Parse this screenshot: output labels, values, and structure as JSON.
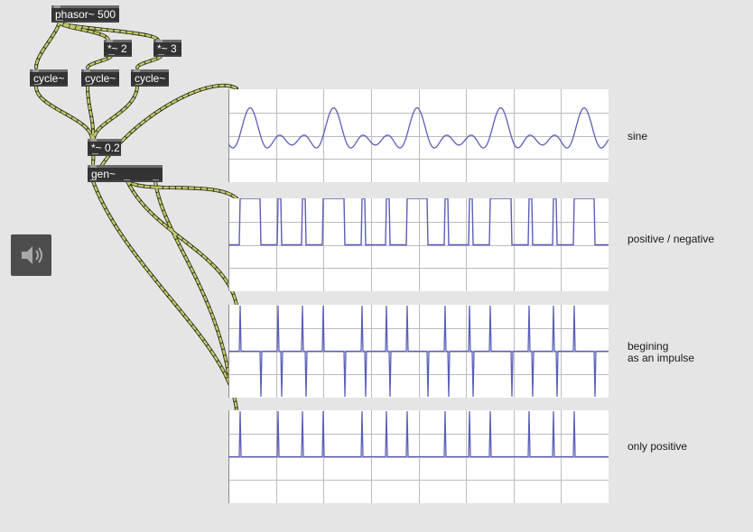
{
  "objects": {
    "phasor": "phasor~ 500",
    "mul2": "*~ 2",
    "mul3": "*~ 3",
    "cycle1": "cycle~",
    "cycle2": "cycle~",
    "cycle3": "cycle~",
    "gain": "*~ 0.2",
    "gen": "gen~"
  },
  "scopes": [
    {
      "label": "sine"
    },
    {
      "label": "positive / negative"
    },
    {
      "label": "begining\nas an impulse"
    },
    {
      "label": "only positive"
    }
  ],
  "colors": {
    "background": "#e5e5e5",
    "object_fill": "#333333",
    "scope_trace": "#5a5fb8",
    "patch_cord": "#c2c96a",
    "grid": "#bcbcbc"
  },
  "speaker": {
    "icon": "speaker-icon"
  }
}
